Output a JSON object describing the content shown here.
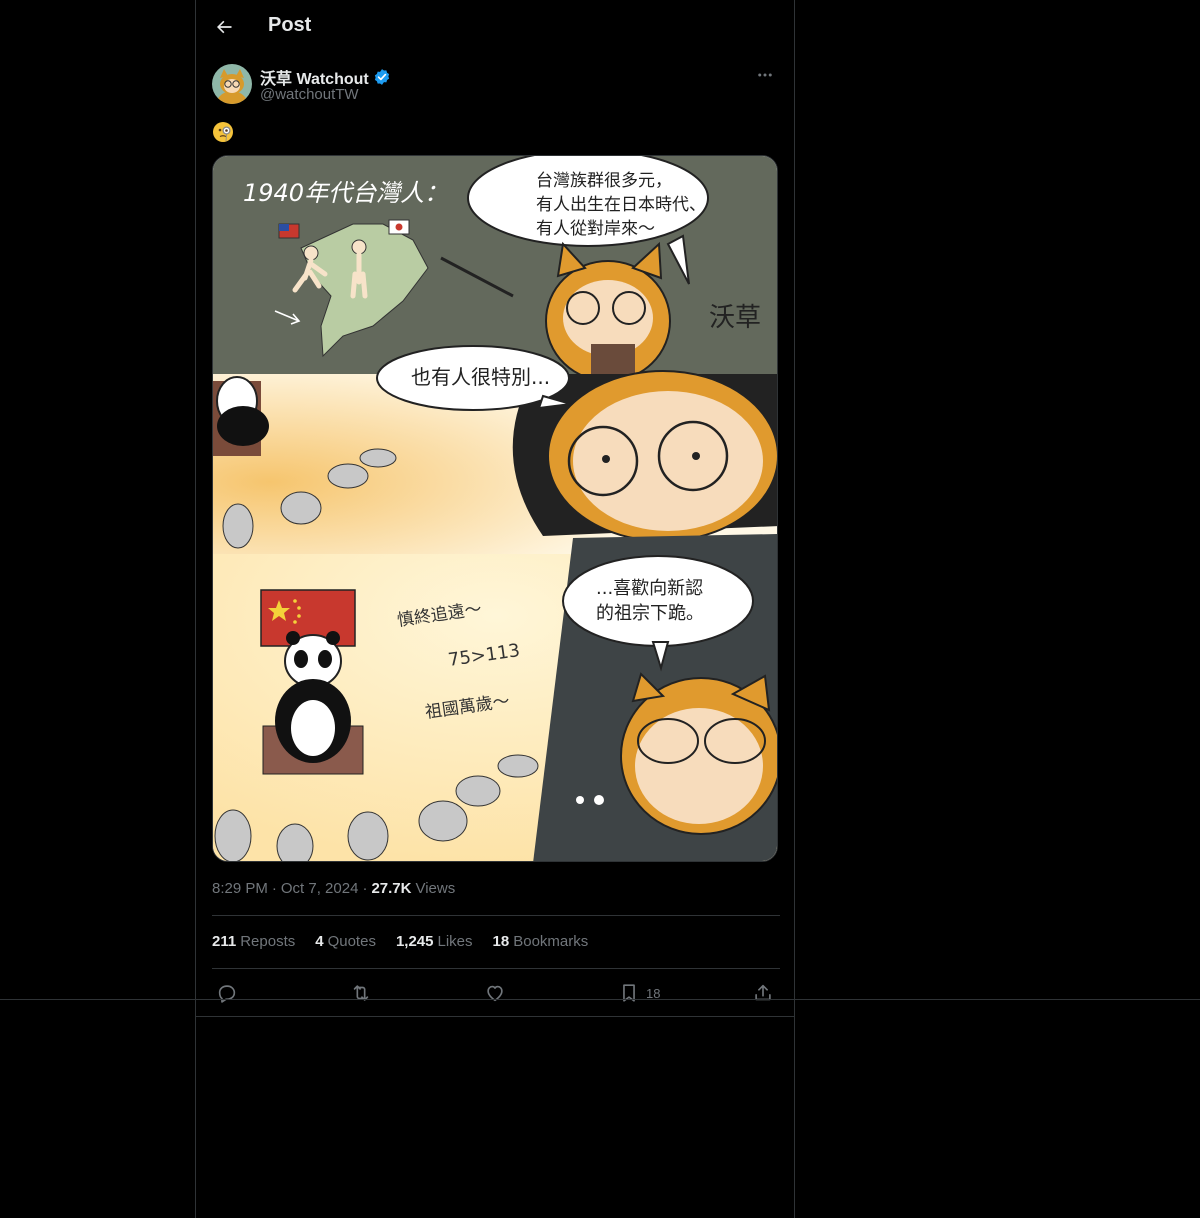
{
  "header": {
    "title": "Post"
  },
  "author": {
    "display_name": "沃草 Watchout",
    "handle": "@watchoutTW",
    "verified": true
  },
  "tweet": {
    "text": "🧐"
  },
  "comic": {
    "panel1_title": "1940年代台灣人：",
    "panel1_bubble": [
      "台灣族群很多元，",
      "有人出生在日本時代、",
      "有人從對岸來～"
    ],
    "signature": "沃草",
    "panel2_bubble": "也有人很特別...",
    "panel3_chant1": "慎終追遠～",
    "panel3_chant2": "75>113",
    "panel3_chant3": "祖國萬歲～",
    "panel3_bubble": [
      "...喜歡向新認",
      "的祖宗下跪。"
    ]
  },
  "meta": {
    "time": "8:29 PM",
    "date": "Oct 7, 2024",
    "views": "27.7K",
    "views_label": "Views"
  },
  "stats": {
    "reposts": "211",
    "reposts_label": "Reposts",
    "quotes": "4",
    "quotes_label": "Quotes",
    "likes": "1,245",
    "likes_label": "Likes",
    "bookmarks": "18",
    "bookmarks_label": "Bookmarks"
  },
  "actions": {
    "bookmark_count": "18"
  },
  "colors": {
    "background": "#000000",
    "border": "#2f3336",
    "text": "#e7e9ea",
    "muted": "#71767b",
    "verified": "#1d9bf0"
  }
}
